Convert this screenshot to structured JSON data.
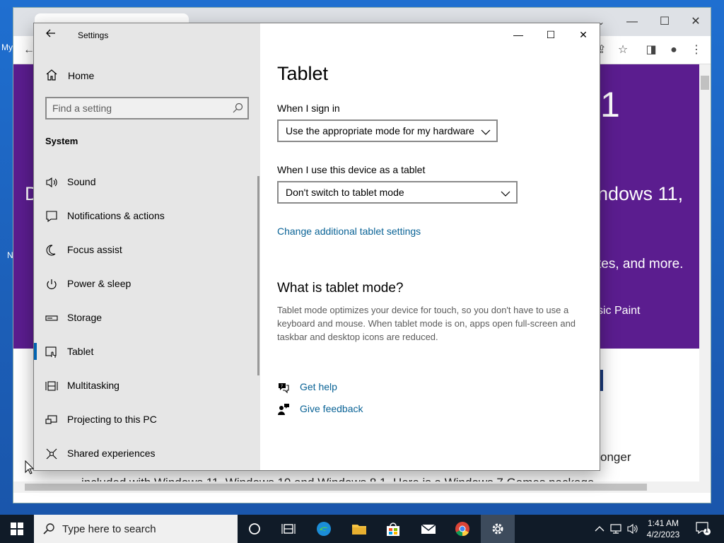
{
  "settings": {
    "app_title": "Settings",
    "home_label": "Home",
    "search_placeholder": "Find a setting",
    "group_label": "System",
    "nav_items": [
      {
        "label": "Sound",
        "icon": "speaker-icon"
      },
      {
        "label": "Notifications & actions",
        "icon": "notification-icon"
      },
      {
        "label": "Focus assist",
        "icon": "moon-icon"
      },
      {
        "label": "Power & sleep",
        "icon": "power-icon"
      },
      {
        "label": "Storage",
        "icon": "storage-icon"
      },
      {
        "label": "Tablet",
        "icon": "tablet-icon",
        "active": true
      },
      {
        "label": "Multitasking",
        "icon": "multitasking-icon"
      },
      {
        "label": "Projecting to this PC",
        "icon": "projecting-icon"
      },
      {
        "label": "Shared experiences",
        "icon": "shared-experiences-icon"
      }
    ],
    "page_title": "Tablet",
    "signin_label": "When I sign in",
    "signin_value": "Use the appropriate mode for my hardware",
    "tablet_label": "When I use this device as a tablet",
    "tablet_value": "Don't switch to tablet mode",
    "additional_link": "Change additional tablet settings",
    "section_title": "What is tablet mode?",
    "section_desc": "Tablet mode optimizes your device for touch, so you don't have to use a keyboard and mouse. When tablet mode is on, apps open full-screen and taskbar and desktop icons are reduced.",
    "get_help": "Get help",
    "give_feedback": "Give feedback"
  },
  "browser_bg": {
    "hero_number": "1",
    "hero_line1": "ndows 11,",
    "hero_line2": "tes, and more.",
    "hero_line3": "sic Paint",
    "hero_left": "D",
    "body_line1": "onger",
    "body_line2": "included with Windows 11, Windows 10 and Windows 8.1. Here is a Windows 7 Games package"
  },
  "taskbar": {
    "search_placeholder": "Type here to search",
    "time": "1:41 AM",
    "date": "4/2/2023",
    "notification_count": "1"
  },
  "colors": {
    "accent": "#0063b1",
    "link": "#0a6396",
    "purple_banner": "#5b1d8f",
    "taskbar": "#101b28"
  }
}
